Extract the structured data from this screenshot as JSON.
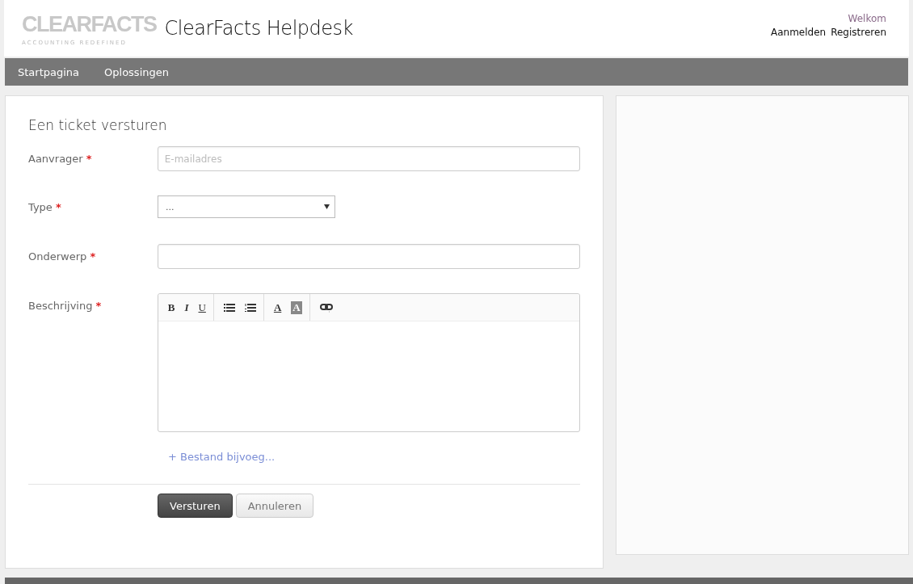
{
  "header": {
    "logo": {
      "wordmark": "CLEARFACTS",
      "tagline": "ACCOUNTING REDEFINED"
    },
    "title": "ClearFacts Helpdesk",
    "welcome": "Welkom",
    "links": [
      "Aanmelden",
      "Registreren"
    ]
  },
  "nav": {
    "items": [
      "Startpagina",
      "Oplossingen"
    ]
  },
  "form": {
    "title": "Een ticket versturen",
    "fields": [
      {
        "kind": "input",
        "label": "Aanvrager",
        "required_mark": "*",
        "placeholder": "E-mailadres"
      },
      {
        "kind": "select",
        "label": "Type",
        "required_mark": "*",
        "value": "..."
      },
      {
        "kind": "input",
        "label": "Onderwerp",
        "required_mark": "*"
      },
      {
        "kind": "editor",
        "label": "Beschrijving",
        "required_mark": "*",
        "toolbar": [
          [
            {
              "kind": "bold",
              "label": "B"
            },
            {
              "kind": "italic",
              "label": "I"
            },
            {
              "kind": "underline",
              "label": "U"
            }
          ],
          [
            {
              "kind": "bullets"
            },
            {
              "kind": "numbers"
            }
          ],
          [
            {
              "kind": "text-color",
              "label": "A"
            },
            {
              "kind": "highlight",
              "label": "A"
            }
          ],
          [
            {
              "kind": "link"
            }
          ]
        ]
      }
    ],
    "attach": "+ Bestand bijvoeg...",
    "buttons": [
      {
        "kind": "primary",
        "label": "Versturen"
      },
      {
        "kind": "secondary",
        "label": "Annuleren"
      }
    ]
  }
}
